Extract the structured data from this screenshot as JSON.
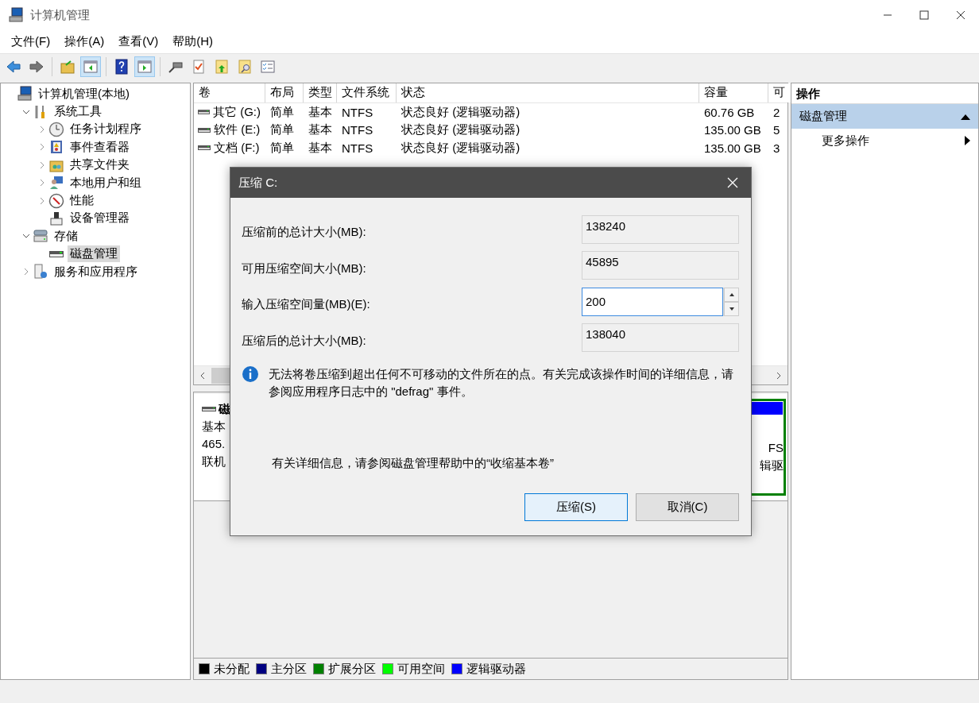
{
  "window": {
    "title": "计算机管理"
  },
  "menu": [
    "文件(F)",
    "操作(A)",
    "查看(V)",
    "帮助(H)"
  ],
  "toolbar": [
    {
      "kind": "back",
      "pressed": false
    },
    {
      "kind": "forward",
      "pressed": false
    },
    {
      "kind": "sep"
    },
    {
      "kind": "up",
      "pressed": false
    },
    {
      "kind": "tree",
      "pressed": true
    },
    {
      "kind": "sep"
    },
    {
      "kind": "help",
      "pressed": false
    },
    {
      "kind": "pane",
      "pressed": true
    },
    {
      "kind": "sep"
    },
    {
      "kind": "connect",
      "pressed": false
    },
    {
      "kind": "check",
      "pressed": false
    },
    {
      "kind": "export",
      "pressed": false
    },
    {
      "kind": "find",
      "pressed": false
    },
    {
      "kind": "list",
      "pressed": false
    }
  ],
  "tree": [
    {
      "label": "计算机管理(本地)",
      "kind": "computer",
      "selected": false,
      "children": [
        {
          "label": "系统工具",
          "kind": "tools",
          "expanded": true,
          "selected": false,
          "children": [
            {
              "label": "任务计划程序",
              "kind": "clock",
              "expanded": false,
              "selected": false
            },
            {
              "label": "事件查看器",
              "kind": "log",
              "expanded": false,
              "selected": false
            },
            {
              "label": "共享文件夹",
              "kind": "share",
              "expanded": false,
              "selected": false
            },
            {
              "label": "本地用户和组",
              "kind": "users",
              "expanded": false,
              "selected": false
            },
            {
              "label": "性能",
              "kind": "gauge",
              "expanded": false,
              "selected": false
            },
            {
              "label": "设备管理器",
              "kind": "device",
              "selected": false
            }
          ]
        },
        {
          "label": "存储",
          "kind": "storage",
          "expanded": true,
          "selected": false,
          "children": [
            {
              "label": "磁盘管理",
              "kind": "disk",
              "selected": true
            }
          ]
        },
        {
          "label": "服务和应用程序",
          "kind": "server",
          "expanded": false,
          "selected": false
        }
      ]
    }
  ],
  "table": {
    "columns": [
      "卷",
      "布局",
      "类型",
      "文件系统",
      "状态",
      "容量",
      "可"
    ],
    "rows": [
      [
        "其它 (G:)",
        "简单",
        "基本",
        "NTFS",
        "状态良好 (逻辑驱动器)",
        "60.76 GB",
        "2"
      ],
      [
        "软件 (E:)",
        "简单",
        "基本",
        "NTFS",
        "状态良好 (逻辑驱动器)",
        "135.00 GB",
        "5"
      ],
      [
        "文档 (F:)",
        "简单",
        "基本",
        "NTFS",
        "状态良好 (逻辑驱动器)",
        "135.00 GB",
        "3"
      ]
    ]
  },
  "disk": {
    "name": "磁",
    "lines": [
      "基本",
      "465.",
      "联机"
    ],
    "partition": [
      "FS",
      "辑驱"
    ]
  },
  "legend": [
    {
      "label": "未分配",
      "color": "#000000"
    },
    {
      "label": "主分区",
      "color": "#000080"
    },
    {
      "label": "扩展分区",
      "color": "#008000"
    },
    {
      "label": "可用空间",
      "color": "#00ff00"
    },
    {
      "label": "逻辑驱动器",
      "color": "#0000ff"
    }
  ],
  "actions": {
    "title": "操作",
    "section": {
      "label": "磁盘管理",
      "expanded": true
    },
    "items": [
      {
        "label": "更多操作"
      }
    ]
  },
  "dialog": {
    "title": "压缩 C:",
    "fields": [
      {
        "label": "压缩前的总计大小(MB):",
        "value": "138240",
        "kind": "readonly"
      },
      {
        "label": "可用压缩空间大小(MB):",
        "value": "45895",
        "kind": "readonly"
      },
      {
        "label": "输入压缩空间量(MB)(E):",
        "value": "200",
        "kind": "spin"
      },
      {
        "label": "压缩后的总计大小(MB):",
        "value": "138040",
        "kind": "readonly"
      }
    ],
    "info": "无法将卷压缩到超出任何不可移动的文件所在的点。有关完成该操作时间的详细信息，请参阅应用程序日志中的 \"defrag\" 事件。",
    "help": "有关详细信息，请参阅磁盘管理帮助中的“收缩基本卷”",
    "buttons": [
      {
        "label": "压缩(S)",
        "default": true
      },
      {
        "label": "取消(C)",
        "default": false
      }
    ]
  }
}
